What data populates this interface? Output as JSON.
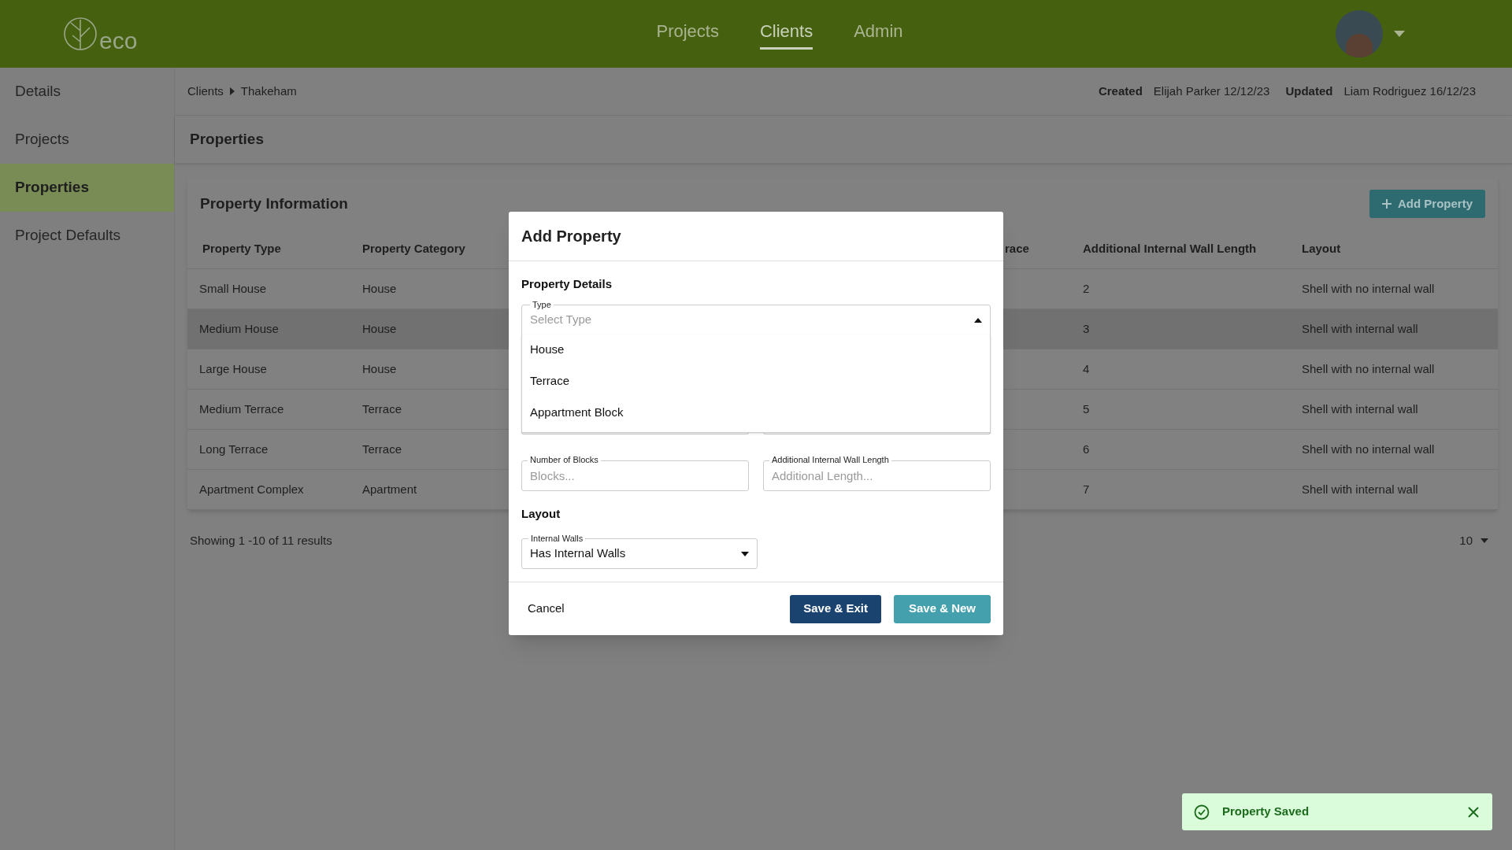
{
  "header": {
    "logo": "eco",
    "nav": [
      {
        "label": "Projects",
        "selected": false
      },
      {
        "label": "Clients",
        "selected": true
      },
      {
        "label": "Admin",
        "selected": false
      }
    ]
  },
  "sidebar": {
    "items": [
      {
        "label": "Details",
        "selected": false
      },
      {
        "label": "Projects",
        "selected": false
      },
      {
        "label": "Properties",
        "selected": true
      },
      {
        "label": "Project Defaults",
        "selected": false
      }
    ]
  },
  "breadcrumb": [
    "Clients",
    "Thakeham"
  ],
  "meta": [
    {
      "label": "Created",
      "value": "Elijah Parker 12/12/23"
    },
    {
      "label": "Updated",
      "value": "Liam Rodriguez 16/12/23"
    }
  ],
  "page_title": "Properties",
  "card": {
    "title": "Property Information",
    "add_button": "Add Property",
    "columns": [
      "Property Type",
      "Property Category",
      "race",
      "Additional Internal Wall Length",
      "Layout"
    ],
    "rows": [
      {
        "type": "Small House",
        "category": "House",
        "wall_length": "2",
        "layout": "Shell with no internal wall",
        "highlighted": false
      },
      {
        "type": "Medium House",
        "category": "House",
        "wall_length": "3",
        "layout": "Shell with internal wall",
        "highlighted": true
      },
      {
        "type": "Large House",
        "category": "House",
        "wall_length": "4",
        "layout": "Shell with no internal wall",
        "highlighted": false
      },
      {
        "type": "Medium Terrace",
        "category": "Terrace",
        "wall_length": "5",
        "layout": "Shell with internal wall",
        "highlighted": false
      },
      {
        "type": "Long Terrace",
        "category": "Terrace",
        "wall_length": "6",
        "layout": "Shell with no internal wall",
        "highlighted": false
      },
      {
        "type": "Apartment Complex",
        "category": "Apartment",
        "wall_length": "7",
        "layout": "Shell with internal wall",
        "highlighted": false
      }
    ]
  },
  "footer": {
    "summary": "Showing 1 -10 of 11 results",
    "page_size": "10"
  },
  "modal": {
    "title": "Add Property",
    "details_heading": "Property Details",
    "type_field": {
      "label": "Type",
      "placeholder": "Select Type",
      "expanded": true,
      "options": [
        "House",
        "Terrace",
        "Appartment Block"
      ]
    },
    "fields": [
      {
        "label": "Number of Blocks",
        "placeholder": "Blocks..."
      },
      {
        "label": "Additional Internal Wall Length",
        "placeholder": "Additional Length..."
      }
    ],
    "layout_heading": "Layout",
    "walls_field": {
      "label": "Internal Walls",
      "value": "Has Internal Walls"
    },
    "cancel": "Cancel",
    "save_exit": "Save & Exit",
    "save_new": "Save & New"
  },
  "toast": {
    "message": "Property Saved"
  }
}
